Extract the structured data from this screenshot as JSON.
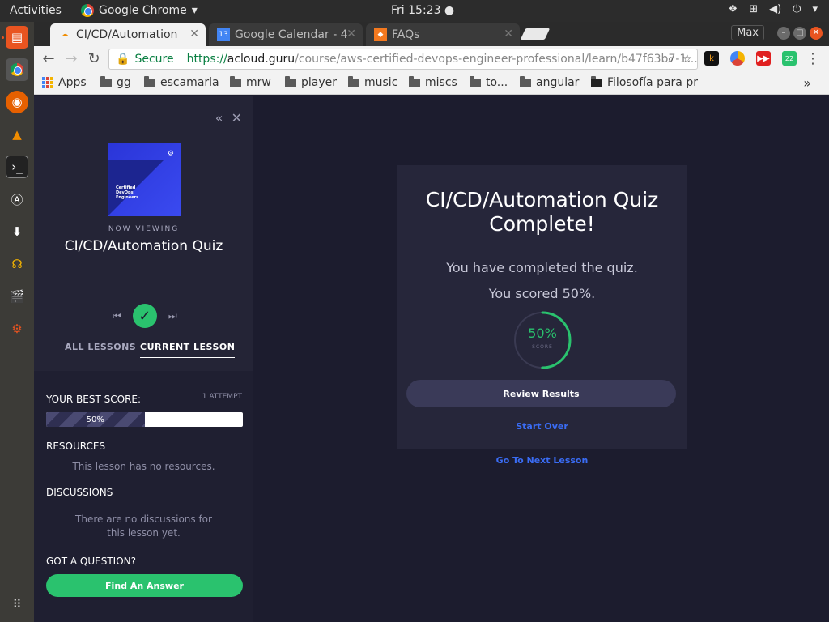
{
  "ubuntu_bar": {
    "activities": "Activities",
    "app_name": "Google Chrome",
    "clock": "Fri 15:23"
  },
  "chrome": {
    "tabs": [
      {
        "label": "CI/CD/Automation",
        "active": true
      },
      {
        "label": "Google Calendar - 4",
        "active": false,
        "badge": "13"
      },
      {
        "label": "FAQs",
        "active": false
      }
    ],
    "max_label": "Max",
    "omnibox": {
      "secure_label": "Secure",
      "url_scheme": "https://",
      "url_host": "acloud.guru",
      "url_path": "/course/aws-certified-devops-engineer-professional/learn/b47f63b7-1..."
    },
    "extension_badge": "22",
    "bookmarks": [
      {
        "label": "Apps",
        "icon": "apps-grid-icon"
      },
      {
        "label": "gg",
        "icon": "folder-icon"
      },
      {
        "label": "escamarla",
        "icon": "folder-icon"
      },
      {
        "label": "mrw",
        "icon": "folder-icon"
      },
      {
        "label": "player",
        "icon": "folder-icon"
      },
      {
        "label": "music",
        "icon": "folder-icon"
      },
      {
        "label": "miscs",
        "icon": "folder-icon"
      },
      {
        "label": "to...",
        "icon": "folder-icon"
      },
      {
        "label": "angular",
        "icon": "folder-icon"
      },
      {
        "label": "Filosofía para pr",
        "icon": "page-thumbnail-icon"
      }
    ]
  },
  "sidebar": {
    "cover_text": "Certified DevOps Engineers",
    "now_viewing": "NOW VIEWING",
    "title": "CI/CD/Automation Quiz",
    "tabs": {
      "all": "ALL LESSONS",
      "current": "CURRENT LESSON"
    },
    "best_score_label": "YOUR BEST SCORE:",
    "attempts": "1 ATTEMPT",
    "best_score_value": "50%",
    "best_score_fraction": 0.5,
    "resources_label": "RESOURCES",
    "resources_empty": "This lesson has no resources.",
    "discussions_label": "DISCUSSIONS",
    "discussions_empty_1": "There are no discussions for",
    "discussions_empty_2": "this lesson yet.",
    "question_label": "GOT A QUESTION?",
    "find_answer": "Find An Answer"
  },
  "result": {
    "title_1": "CI/CD/Automation Quiz",
    "title_2": "Complete!",
    "completed_text": "You have completed the quiz.",
    "score_text": "You scored 50%.",
    "ring_value": "50%",
    "ring_label": "SCORE",
    "ring_fraction": 0.5,
    "review_results": "Review Results",
    "start_over": "Start Over",
    "next_lesson": "Go To Next Lesson"
  },
  "colors": {
    "accent_green": "#2ac26e",
    "link_blue": "#3a6cf4",
    "page_bg": "#1c1c2e",
    "ubuntu_orange": "#e95420"
  }
}
